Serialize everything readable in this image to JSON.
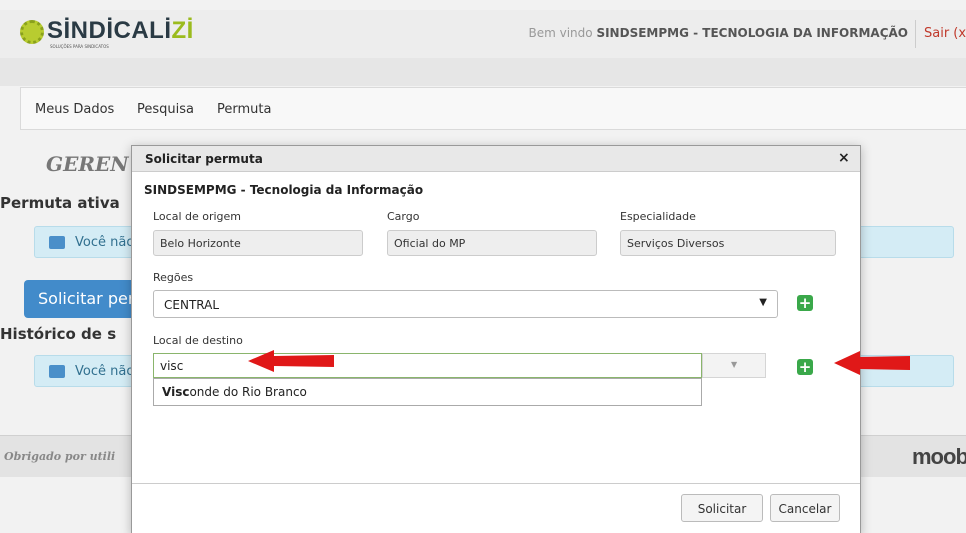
{
  "brand": {
    "logo_main": "SİNDİCALİ",
    "logo_accent": "Zİ",
    "logo_tagline": "SOLUÇÕES PARA SINDICATOS"
  },
  "header": {
    "welcome_prefix": "Bem vindo",
    "welcome_user": "SINDSEMPMG - TECNOLOGIA DA INFORMAÇÃO",
    "logout": "Sair (x)"
  },
  "nav": {
    "items": [
      "Meus Dados",
      "Pesquisa",
      "Permuta"
    ]
  },
  "background": {
    "title": "GEREN",
    "active_heading": "Permuta ativa",
    "info1": "Você não",
    "request_button": "Solicitar per",
    "history_heading": "Histórico de s",
    "info2": "Você não",
    "footer_text": "Obrigado por utili",
    "footer_logo": "moob"
  },
  "modal": {
    "title": "Solicitar permuta",
    "close": "×",
    "organization": "SINDSEMPMG - Tecnologia da Informação",
    "origin_label": "Local de origem",
    "origin_value": "Belo Horizonte",
    "cargo_label": "Cargo",
    "cargo_value": "Oficial do MP",
    "specialty_label": "Especialidade",
    "specialty_value": "Serviços Diversos",
    "regions_label": "Regões",
    "regions_value": "CENTRAL",
    "destination_label": "Local de destino",
    "destination_input": "visc",
    "suggestion_match": "Visc",
    "suggestion_rest": "onde do Rio Branco",
    "submit_button": "Solicitar",
    "cancel_button": "Cancelar"
  },
  "colors": {
    "accent_green": "#3aa84a",
    "annotation_red": "#e01818",
    "primary_blue": "#428bca"
  }
}
